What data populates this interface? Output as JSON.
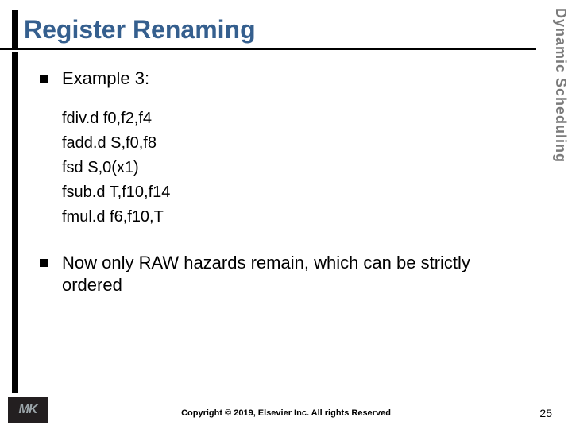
{
  "title": "Register Renaming",
  "sidebar_label": "Dynamic Scheduling",
  "bullets": [
    {
      "text": "Example 3:"
    },
    {
      "text": "Now only RAW hazards remain, which can be strictly ordered"
    }
  ],
  "code_lines": [
    "fdiv.d f0,f2,f4",
    "fadd.d S,f0,f8",
    "fsd S,0(x1)",
    "fsub.d T,f10,f14",
    "fmul.d f6,f10,T"
  ],
  "copyright": "Copyright © 2019, Elsevier Inc. All rights Reserved",
  "page_number": "25",
  "logo_text": "MK"
}
